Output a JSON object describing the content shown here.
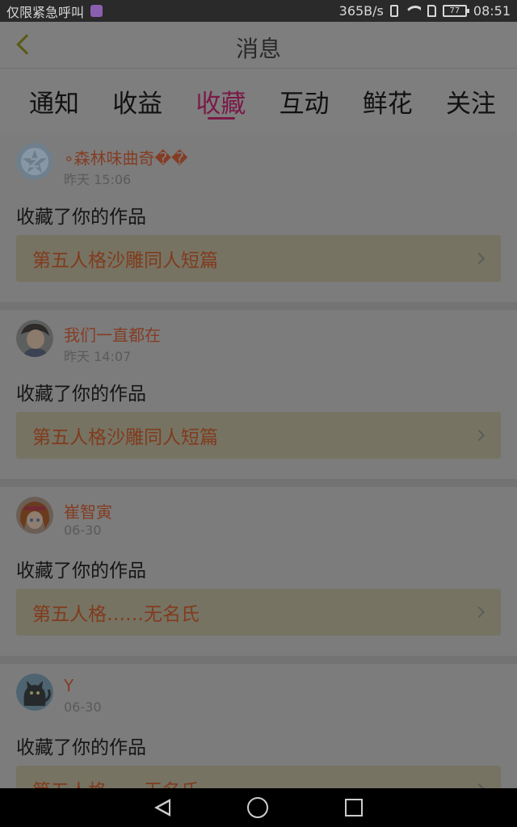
{
  "status_bar": {
    "carrier": "仅限紧急呼叫",
    "net_speed": "365B/s",
    "battery": "77",
    "time": "08:51"
  },
  "header": {
    "title": "消息"
  },
  "tabs": [
    {
      "label": "通知",
      "active": false
    },
    {
      "label": "收益",
      "active": false
    },
    {
      "label": "收藏",
      "active": true
    },
    {
      "label": "互动",
      "active": false
    },
    {
      "label": "鲜花",
      "active": false
    },
    {
      "label": "关注",
      "active": false
    }
  ],
  "items": [
    {
      "username": "∘森林味曲奇��",
      "time": "昨天 15:06",
      "action": "收藏了你的作品",
      "work": "第五人格沙雕同人短篇",
      "avatar": "default-avatar"
    },
    {
      "username": "我们一直都在",
      "time": "昨天 14:07",
      "action": "收藏了你的作品",
      "work": "第五人格沙雕同人短篇",
      "avatar": "user-photo"
    },
    {
      "username": "崔智寅",
      "time": "06-30",
      "action": "收藏了你的作品",
      "work": "第五人格……无名氏",
      "avatar": "anime-avatar"
    },
    {
      "username": "Y",
      "time": "06-30",
      "action": "收藏了你的作品",
      "work": "第五人格……无名氏",
      "avatar": "cat-avatar"
    }
  ],
  "colors": {
    "accent": "#7a1a48",
    "username": "#843d24",
    "work_title": "#813b1d"
  }
}
